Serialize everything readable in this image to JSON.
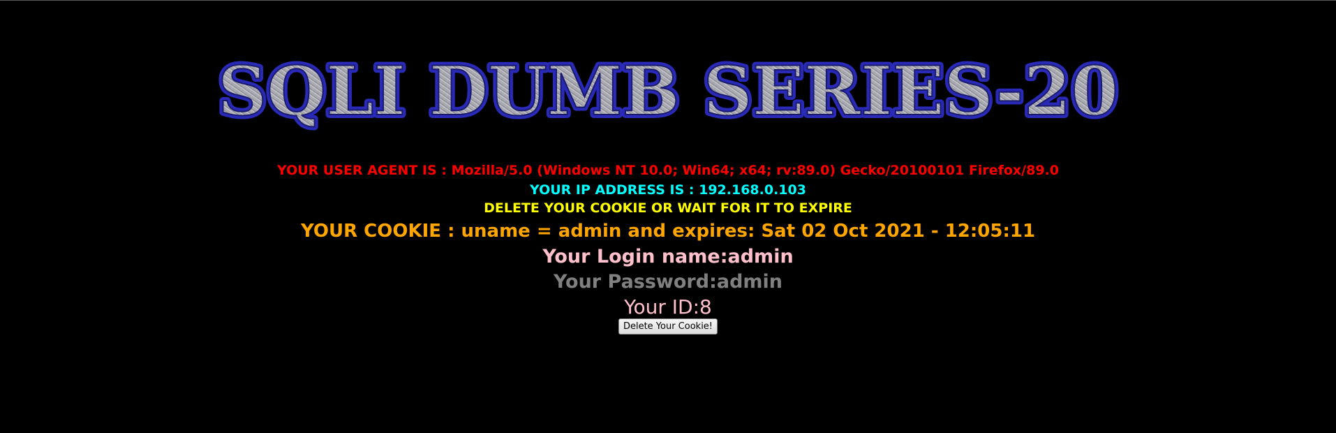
{
  "banner": {
    "title": "SQLI DUMB SERIES-20"
  },
  "info": {
    "user_agent": "YOUR USER AGENT IS : Mozilla/5.0 (Windows NT 10.0; Win64; x64; rv:89.0) Gecko/20100101 Firefox/89.0",
    "ip_address": "YOUR IP ADDRESS IS : 192.168.0.103",
    "delete_notice": "DELETE YOUR COOKIE OR WAIT FOR IT TO EXPIRE",
    "cookie": "YOUR COOKIE : uname = admin and expires: Sat 02 Oct 2021 - 12:05:11",
    "login_name": "Your Login name:admin",
    "password": "Your Password:admin",
    "user_id": "Your ID:8"
  },
  "actions": {
    "delete_cookie_label": "Delete Your Cookie!"
  },
  "colors": {
    "background": "#000000",
    "user_agent": "#ff0000",
    "ip_address": "#00ffff",
    "delete_notice": "#ffff00",
    "cookie": "#ffa500",
    "login_name": "#ffc0cb",
    "password": "#808080",
    "user_id": "#ffc0cb",
    "banner_outline": "#2a2ab8",
    "banner_fill": "#a8a8b0"
  }
}
